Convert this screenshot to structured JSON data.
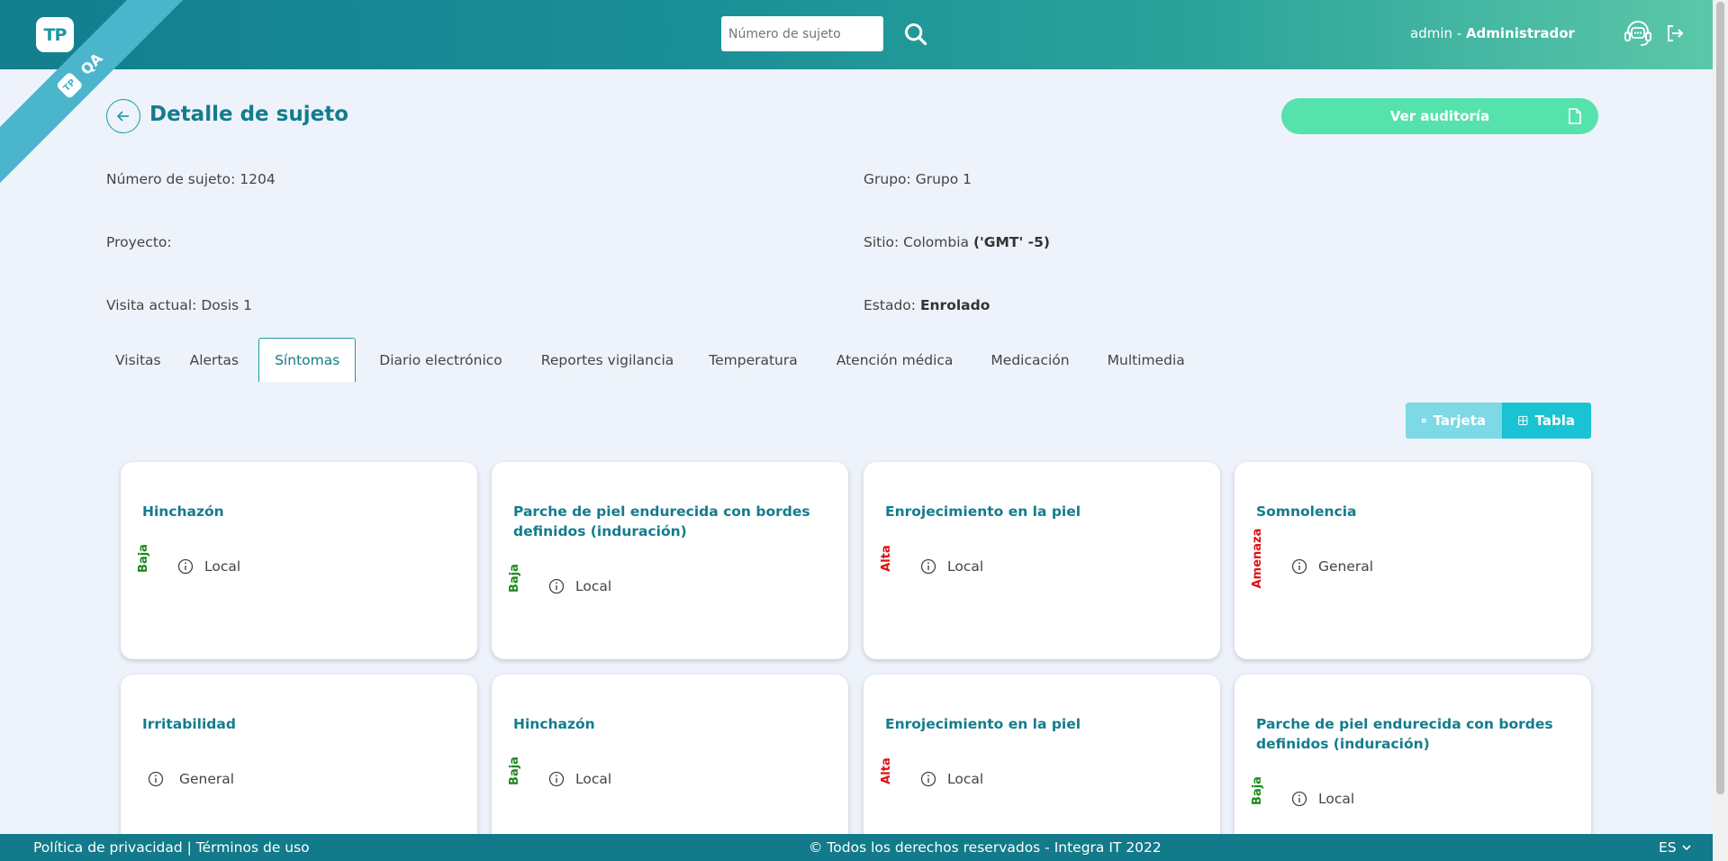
{
  "header": {
    "logo_text": "TP",
    "ribbon_text": "QA",
    "search_placeholder": "Número de sujeto",
    "user_name": "admin",
    "user_separator": " - ",
    "user_role": "Administrador"
  },
  "page": {
    "title": "Detalle de sujeto",
    "audit_button": "Ver auditoría"
  },
  "subject": {
    "number_label": "Número de sujeto:",
    "number_value": "1204",
    "group_label": "Grupo:",
    "group_value": "Grupo 1",
    "project_label": "Proyecto:",
    "project_value": "",
    "site_label": "Sitio:",
    "site_value": "Colombia",
    "site_tz": "('GMT' -5)",
    "visit_label": "Visita actual:",
    "visit_value": "Dosis 1",
    "state_label": "Estado:",
    "state_value": "Enrolado"
  },
  "tabs": [
    {
      "label": "Visitas"
    },
    {
      "label": "Alertas"
    },
    {
      "label": "Síntomas"
    },
    {
      "label": "Diario electrónico"
    },
    {
      "label": "Reportes vigilancia"
    },
    {
      "label": "Temperatura"
    },
    {
      "label": "Atención médica"
    },
    {
      "label": "Medicación"
    },
    {
      "label": "Multimedia"
    }
  ],
  "view_toggle": {
    "card_label": "Tarjeta",
    "table_label": "Tabla"
  },
  "cards": [
    {
      "title": "Hinchazón",
      "severity": "Baja",
      "severity_color": "#1a8a1a",
      "type": "Local"
    },
    {
      "title": "Parche de piel endurecida con bordes definidos (induración)",
      "severity": "Baja",
      "severity_color": "#1a8a1a",
      "type": "Local"
    },
    {
      "title": "Enrojecimiento en la piel",
      "severity": "Alta",
      "severity_color": "#e01010",
      "type": "Local"
    },
    {
      "title": "Somnolencia",
      "severity": "Amenaza",
      "severity_color": "#e01010",
      "type": "General"
    },
    {
      "title": "Irritabilidad",
      "severity": "",
      "severity_color": "",
      "type": "General"
    },
    {
      "title": "Hinchazón",
      "severity": "Baja",
      "severity_color": "#1a8a1a",
      "type": "Local"
    },
    {
      "title": "Enrojecimiento en la piel",
      "severity": "Alta",
      "severity_color": "#e01010",
      "type": "Local"
    },
    {
      "title": "Parche de piel endurecida con bordes definidos (induración)",
      "severity": "Baja",
      "severity_color": "#1a8a1a",
      "type": "Local"
    }
  ],
  "footer": {
    "privacy": "Política de privacidad",
    "separator": " | ",
    "terms": "Términos de uso",
    "copyright": "© Todos los derechos reservados - Integra IT 2022",
    "language": "ES"
  },
  "colors": {
    "primary": "#137c8c",
    "accent_green": "#56e2ac",
    "toggle_active": "#19c3d4",
    "footer": "#127a8a"
  }
}
